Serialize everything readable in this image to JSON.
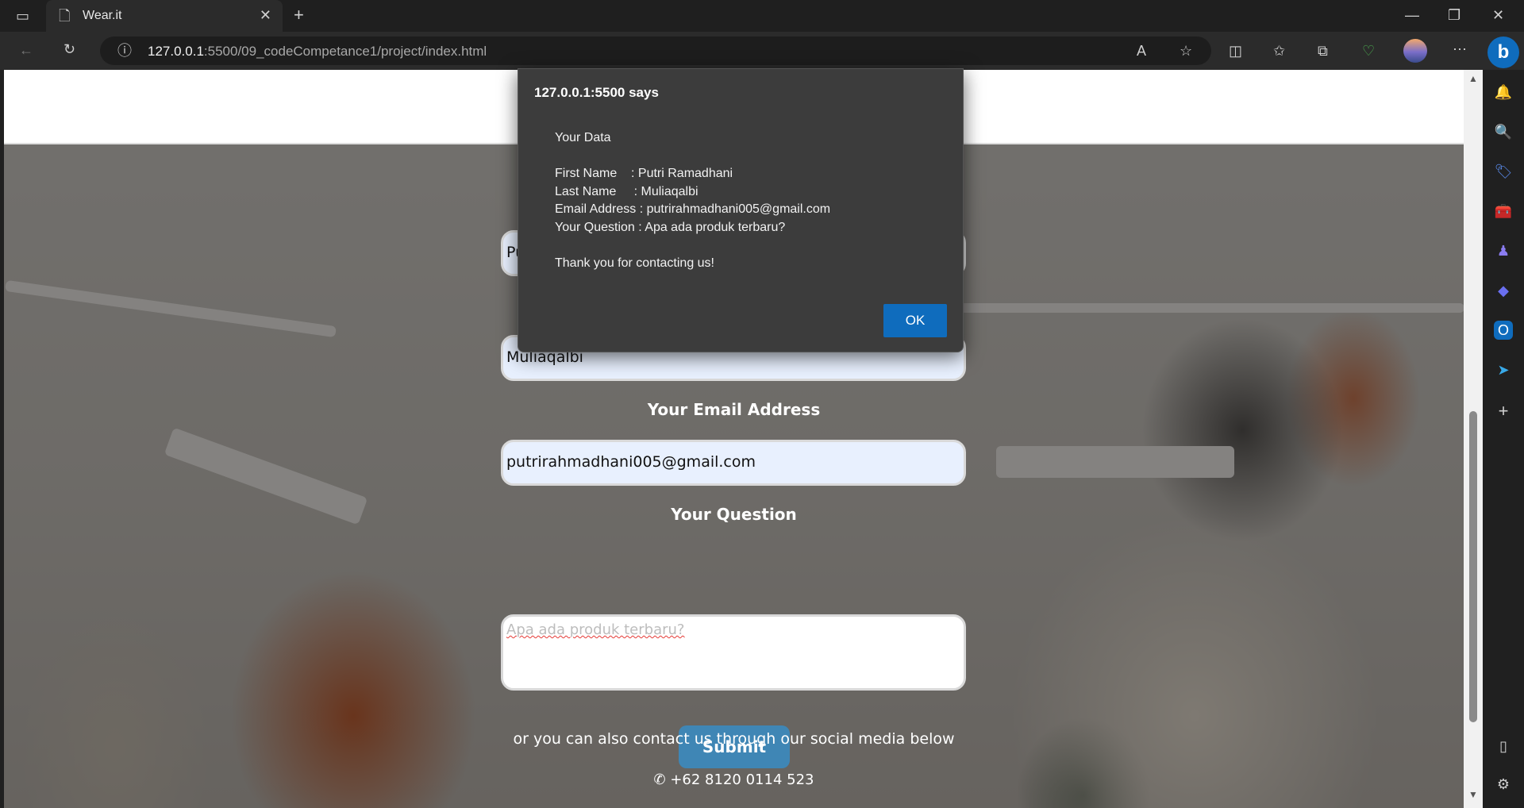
{
  "browser": {
    "tab_title": "Wear.it",
    "url_host": "127.0.0.1",
    "url_path": ":5500/09_codeCompetance1/project/index.html"
  },
  "form": {
    "first_name_value": "Pu",
    "last_name_value": "Muliaqalbi",
    "email_label": "Your Email Address",
    "email_value": "putrirahmadhani005@gmail.com",
    "question_label": "Your Question",
    "question_placeholder": "Apa ada produk terbaru?",
    "submit_label": "Submit",
    "social_text": "or you can also contact us through our social media below",
    "phone": "+62 8120 0114 523"
  },
  "dialog": {
    "title": "127.0.0.1:5500 says",
    "heading": "Your Data",
    "first_name_line": "First Name    : Putri Ramadhani",
    "last_name_line": "Last Name     : Muliaqalbi",
    "email_line": "Email Address : putrirahmadhani005@gmail.com",
    "question_line": "Your Question : Apa ada produk terbaru?",
    "thanks": "Thank you for contacting us!",
    "ok_label": "OK"
  },
  "colors": {
    "accent": "#0f6cbd",
    "submit": "#3f86b5"
  }
}
